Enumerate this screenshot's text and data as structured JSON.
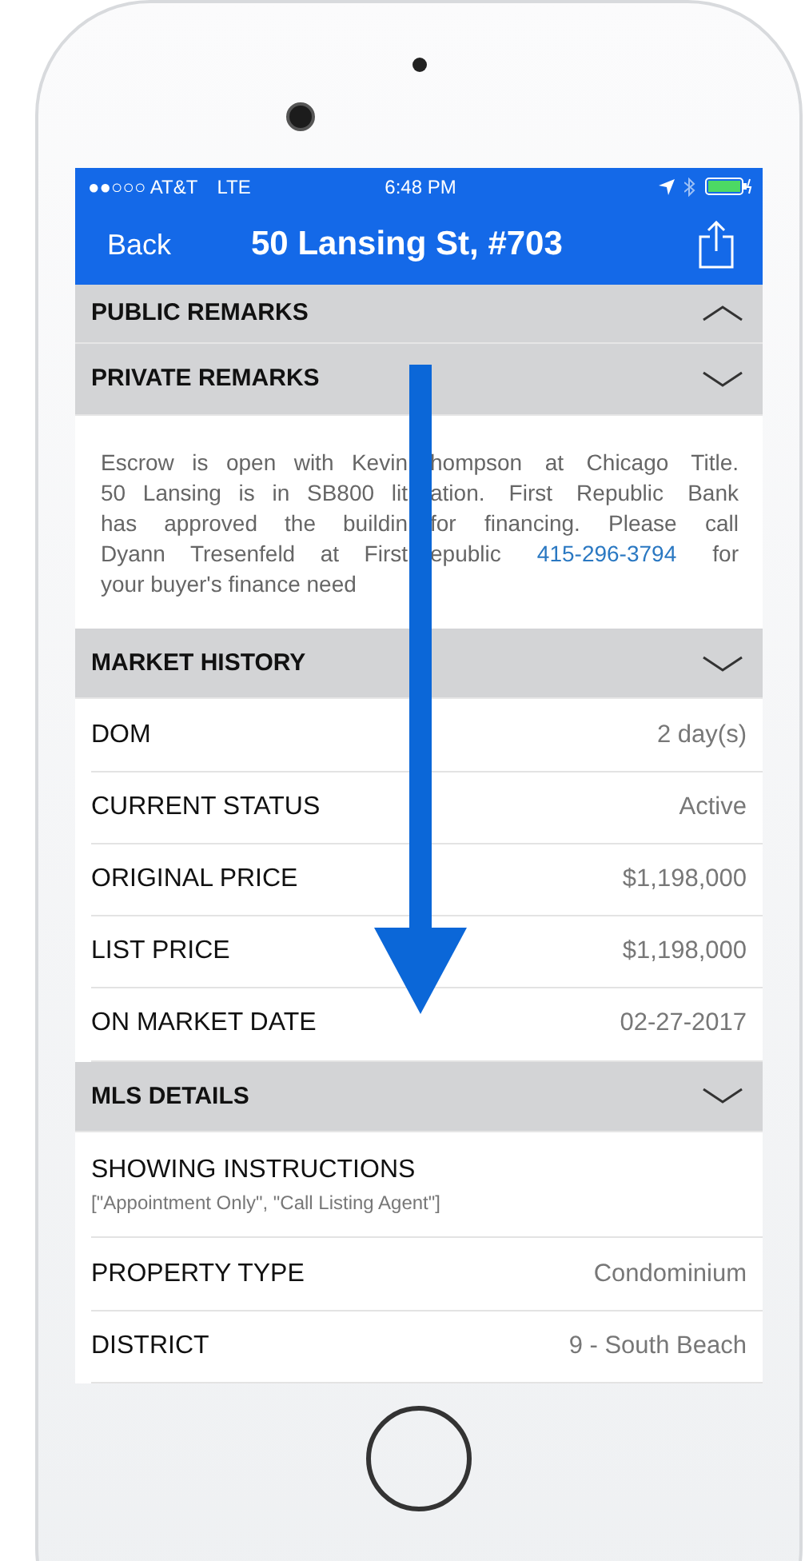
{
  "status_bar": {
    "carrier": "●●○○○ AT&T",
    "network": "LTE",
    "time": "6:48 PM"
  },
  "nav": {
    "back": "Back",
    "title": "50 Lansing St, #703"
  },
  "sections": [
    {
      "title": "PUBLIC REMARKS",
      "expanded": true
    },
    {
      "title": "PRIVATE REMARKS",
      "expanded": false,
      "lines": [
        {
          "left": "Escrow is open with Kevin",
          "right": "hompson at Chicago Title."
        },
        {
          "left": "50 Lansing is in SB800 lit",
          "right": "ation.  First Republic Bank"
        },
        {
          "left": "has approved the buildin",
          "right": "for financing.  Please call"
        },
        {
          "left": "Dyann Tresenfeld at First",
          "right": "epublic",
          "phone": "415-296-3794",
          "right_after": "for"
        },
        {
          "left": "your buyer's finance need"
        }
      ]
    },
    {
      "title": "MARKET HISTORY",
      "expanded": false,
      "rows": [
        {
          "kind": "inline",
          "label": "DOM",
          "value": "2 day(s)"
        },
        {
          "kind": "inline",
          "label": "CURRENT STATUS",
          "value": "Active"
        },
        {
          "kind": "inline",
          "label": "ORIGINAL PRICE",
          "value": "$1,198,000"
        },
        {
          "kind": "inline",
          "label": "LIST PRICE",
          "value": "$1,198,000"
        },
        {
          "kind": "inline",
          "label": "ON MARKET DATE",
          "value": "02-27-2017"
        }
      ]
    },
    {
      "title": "MLS DETAILS",
      "expanded": false,
      "rows": [
        {
          "kind": "stacked",
          "label": "SHOWING INSTRUCTIONS",
          "value": "[\"Appointment Only\", \"Call Listing Agent\"]"
        },
        {
          "kind": "inline",
          "label": "PROPERTY TYPE",
          "value": "Condominium"
        },
        {
          "kind": "inline",
          "label": "DISTRICT",
          "value": "9 - South Beach"
        }
      ]
    }
  ]
}
